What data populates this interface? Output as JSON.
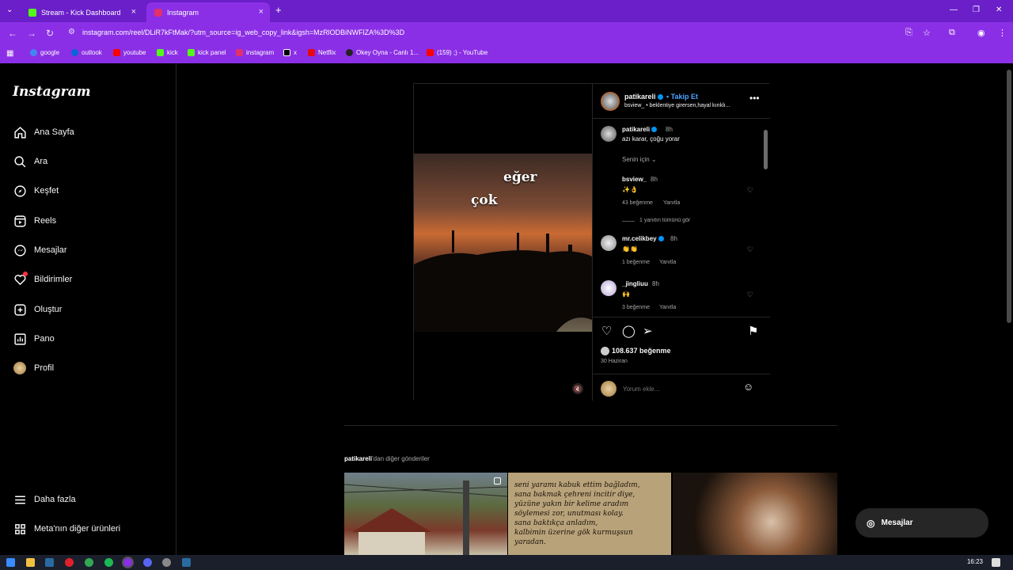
{
  "browser": {
    "tabs": [
      {
        "title": "Stream - Kick Dashboard",
        "active": false,
        "favicon": "kick-icon"
      },
      {
        "title": "Instagram",
        "active": true,
        "favicon": "instagram-icon"
      }
    ],
    "new_tab": "+",
    "url": "instagram.com/reel/DLiR7kFtMak/?utm_source=ig_web_copy_link&igsh=MzRlODBiNWFlZA%3D%3D",
    "bookmarks": [
      {
        "label": "google",
        "icon": "google-icon",
        "color": "#4285f4"
      },
      {
        "label": "outlook",
        "icon": "outlook-icon",
        "color": "#0a64d6"
      },
      {
        "label": "youtube",
        "icon": "youtube-icon",
        "color": "#ff0000"
      },
      {
        "label": "kick",
        "icon": "kick-icon",
        "color": "#53fc18"
      },
      {
        "label": "kick panel",
        "icon": "kick-icon",
        "color": "#53fc18"
      },
      {
        "label": "instagram",
        "icon": "instagram-icon",
        "color": "#e1306c"
      },
      {
        "label": "x",
        "icon": "x-icon",
        "color": "#000000"
      },
      {
        "label": "Netflix",
        "icon": "netflix-icon",
        "color": "#e50914"
      },
      {
        "label": "Okey Oyna - Canlı 1...",
        "icon": "okey-icon",
        "color": "#222222"
      },
      {
        "label": "(159) ;) - YouTube",
        "icon": "youtube-icon",
        "color": "#ff0000"
      }
    ],
    "colors": {
      "accent": "#8b2fe6",
      "tabbar": "#6a1fc9"
    }
  },
  "sidebar": {
    "logo": "Instagram",
    "items": [
      {
        "label": "Ana Sayfa",
        "icon": "home-icon"
      },
      {
        "label": "Ara",
        "icon": "search-icon"
      },
      {
        "label": "Keşfet",
        "icon": "compass-icon"
      },
      {
        "label": "Reels",
        "icon": "reels-icon"
      },
      {
        "label": "Mesajlar",
        "icon": "messenger-icon"
      },
      {
        "label": "Bildirimler",
        "icon": "heart-icon"
      },
      {
        "label": "Oluştur",
        "icon": "plus-square-icon"
      },
      {
        "label": "Pano",
        "icon": "chart-icon"
      },
      {
        "label": "Profil",
        "icon": "avatar"
      }
    ],
    "bottom": [
      {
        "label": "Daha fazla",
        "icon": "menu-icon"
      },
      {
        "label": "Meta'nın diğer ürünleri",
        "icon": "grid-icon"
      }
    ]
  },
  "post": {
    "video_words": [
      "eğer",
      "çok"
    ],
    "author": "patikareli",
    "follow": "Takip Et",
    "audio": "bsview_ • beklentiye girersen,hayal kırıklı...",
    "caption": {
      "user": "patikareli",
      "time": "8h",
      "text": "azı karar, çoğu yorar",
      "translate": "Senin için"
    },
    "comments": [
      {
        "user": "bsview_",
        "time": "8h",
        "text": "✨👌",
        "likes": "43 beğenme",
        "reply": "Yanıtla",
        "view_replies": "1 yanıtın tümünü gör"
      },
      {
        "user": "mr.celikbey",
        "verified": true,
        "time": "8h",
        "text": "👏👏",
        "likes": "1 beğenme",
        "reply": "Yanıtla"
      },
      {
        "user": "_jingliuu",
        "time": "8h",
        "text": "🙌",
        "likes": "3 beğenme",
        "reply": "Yanıtla"
      }
    ],
    "likes": "108.637 beğenme",
    "date": "30 Haziran",
    "comment_placeholder": "Yorum ekle..."
  },
  "more_posts": {
    "author": "patikareli",
    "suffix": "'dan diğer gönderiler",
    "poem_lines": [
      "seni yaramı kabuk ettim bağladım,",
      "sana bakmak çehreni incitir diye,",
      "yüzüne yakın bir kelime aradım",
      "söylemesi zor, unutması kolay.",
      "sana baktıkça anladım,",
      "kalbimin üzerine gök kurmuşsun",
      "yaradan."
    ]
  },
  "messages_button": "Mesajlar",
  "taskbar": {
    "time": "16:23"
  }
}
